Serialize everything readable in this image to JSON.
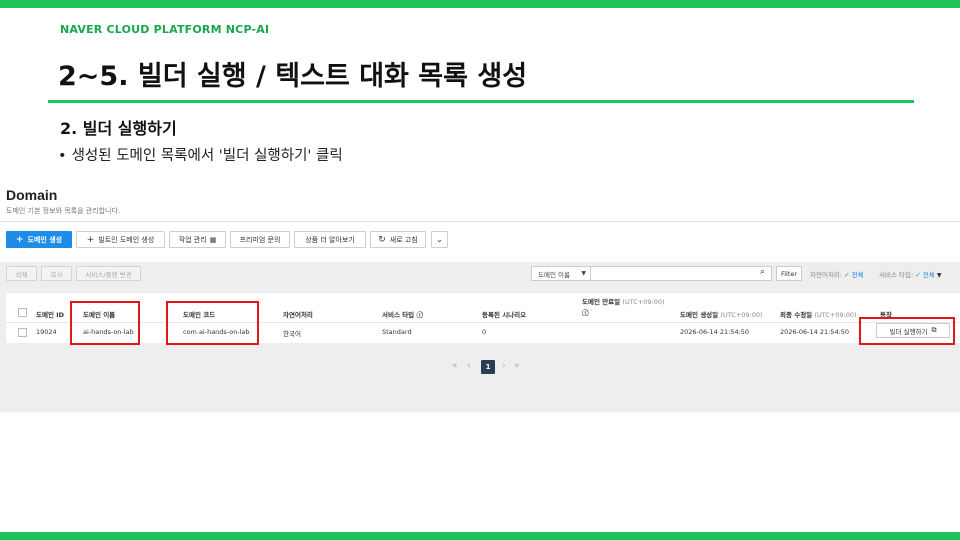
{
  "slide": {
    "brand": "NAVER CLOUD PLATFORM  NCP-AI",
    "title": "2~5. 빌더 실행 / 텍스트 대화 목록 생성",
    "subhead": "2. 빌더 실행하기",
    "bullet_dot": "•",
    "bullet_text": "생성된 도메인 목록에서 '빌더 실행하기' 클릭"
  },
  "console": {
    "title": "Domain",
    "subtitle": "도메인 기본 정보와 목록을 관리합니다.",
    "toolbar": {
      "create": "도메인 생성",
      "create_icon": "plus-icon",
      "builtin": "빌트인 도메인 생성",
      "jobs": "작업 관리",
      "premium": "프리미엄 문의",
      "more": "상품 더 알아보기",
      "refresh": "새로 고침",
      "expand_icon": "chevron-down-icon"
    },
    "secondary": {
      "delete": "삭제",
      "copy": "복사",
      "change_type": "서비스/플랜 변경"
    },
    "search": {
      "field_select": "도메인 이름",
      "filter": "Filter",
      "nlp_label": "자연어처리:",
      "nlp_value": "전체",
      "type_label": "서비스 타입:",
      "type_value": "전체"
    },
    "table": {
      "headers": {
        "id": "도메인 ID",
        "name": "도메인 이름",
        "code": "도메인 코드",
        "nlp": "자연어처리",
        "service": "서비스 타입",
        "scenarios": "등록된 시나리오",
        "expiry": "도메인 만료일",
        "expiry_tz": "(UTC+09:00)",
        "created": "도메인 생성일",
        "created_tz": "(UTC+09:00)",
        "modified": "최종 수정일",
        "modified_tz": "(UTC+09:00)",
        "action": "동작"
      },
      "rows": [
        {
          "id": "19024",
          "name": "ai-hands-on-lab",
          "code": "com.ai-hands-on-lab",
          "nlp": "한국어",
          "service": "Standard",
          "scenarios": "0",
          "created": "2026-06-14 21:54:50",
          "modified": "2026-06-14 21:54:50",
          "action": "빌더 실행하기"
        }
      ]
    },
    "pagination": {
      "current": "1",
      "first": "«",
      "prev": "‹",
      "next": "›",
      "last": "»"
    }
  },
  "colors": {
    "brand_green": "#1ec35a",
    "primary_blue": "#1f8ce8",
    "highlight_red": "#e01818"
  }
}
